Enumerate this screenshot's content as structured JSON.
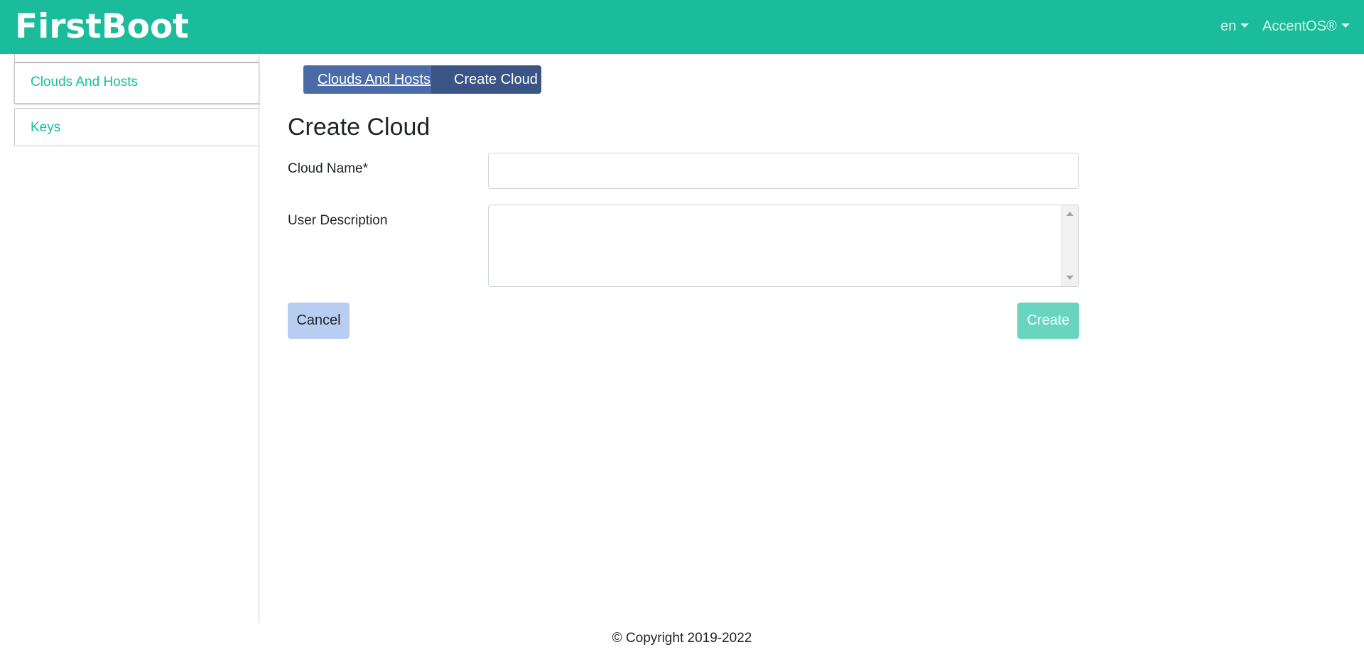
{
  "app": {
    "brand": "FirstBoot"
  },
  "topnav": {
    "language": "en",
    "user": "AccentOS®"
  },
  "sidebar": {
    "items": [
      {
        "label": "Clouds And Hosts",
        "active": true
      },
      {
        "label": "Keys",
        "active": false
      }
    ]
  },
  "breadcrumb": {
    "parent": "Clouds And Hosts",
    "current": "Create Cloud"
  },
  "page": {
    "title": "Create Cloud"
  },
  "form": {
    "cloud_name_label": "Cloud Name*",
    "cloud_name_value": "",
    "user_description_label": "User Description",
    "user_description_value": "",
    "cancel_label": "Cancel",
    "create_label": "Create"
  },
  "footer": {
    "copyright": "© Copyright 2019-2022"
  },
  "colors": {
    "accent": "#1abc9c",
    "breadcrumb_parent": "#4a6aa8",
    "breadcrumb_current": "#3a5585",
    "cancel_button": "#b8cdf2",
    "create_button": "#69d4bf"
  }
}
